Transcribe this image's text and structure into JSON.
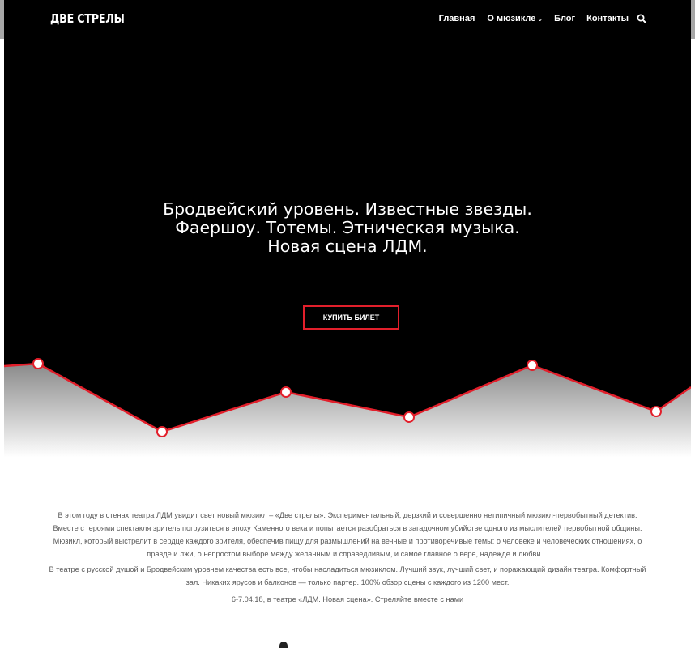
{
  "header": {
    "logo": "ДВЕ СТРЕЛЫ",
    "nav": [
      {
        "label": "Главная"
      },
      {
        "label": "О мюзикле",
        "has_dropdown": true
      },
      {
        "label": "Блог"
      },
      {
        "label": "Контакты"
      }
    ],
    "search_icon": "search-icon"
  },
  "hero": {
    "headline_lines": [
      "Бродвейский уровень. Известные звезды.",
      "Фаершоу. Тотемы. Этническая музыка.",
      "Новая сцена ЛДМ."
    ],
    "cta_label": "КУПИТЬ БИЛЕТ"
  },
  "content": {
    "paragraphs": [
      "В этом году в стенах театра ЛДМ увидит свет новый мюзикл – «Две стрелы». Экспериментальный, дерзкий и совершенно нетипичный мюзикл-первобытный детектив. Вместе с героями спектакля зритель погрузиться в эпоху Каменного века и попытается разобраться в загадочном убийстве одного из мыслителей первобытной общины.",
      "Мюзикл, который выстрелит в сердце каждого зрителя, обеспечив пищу для размышлений на вечные и противоречивые темы: о человеке и человеческих отношениях, о правде и лжи, о непростом выборе между желанным и справедливым, и самое главное о вере, надежде и любви…",
      "В театре с русской душой и Бродвейским уровнем качества есть все, чтобы насладиться мюзиклом. Лучший звук, лучший свет, и поражающий дизайн театра. Комфортный зал. Никаких ярусов и балконов — только партер. 100% обзор сцены с каждого из 1200 мест.",
      "6-7.04.18, в театре «ЛДМ. Новая сцена». Стреляйте вместе с нами"
    ]
  },
  "colors": {
    "accent": "#e21f2b",
    "hero_bg": "#000000",
    "text": "#5a5a5a"
  }
}
